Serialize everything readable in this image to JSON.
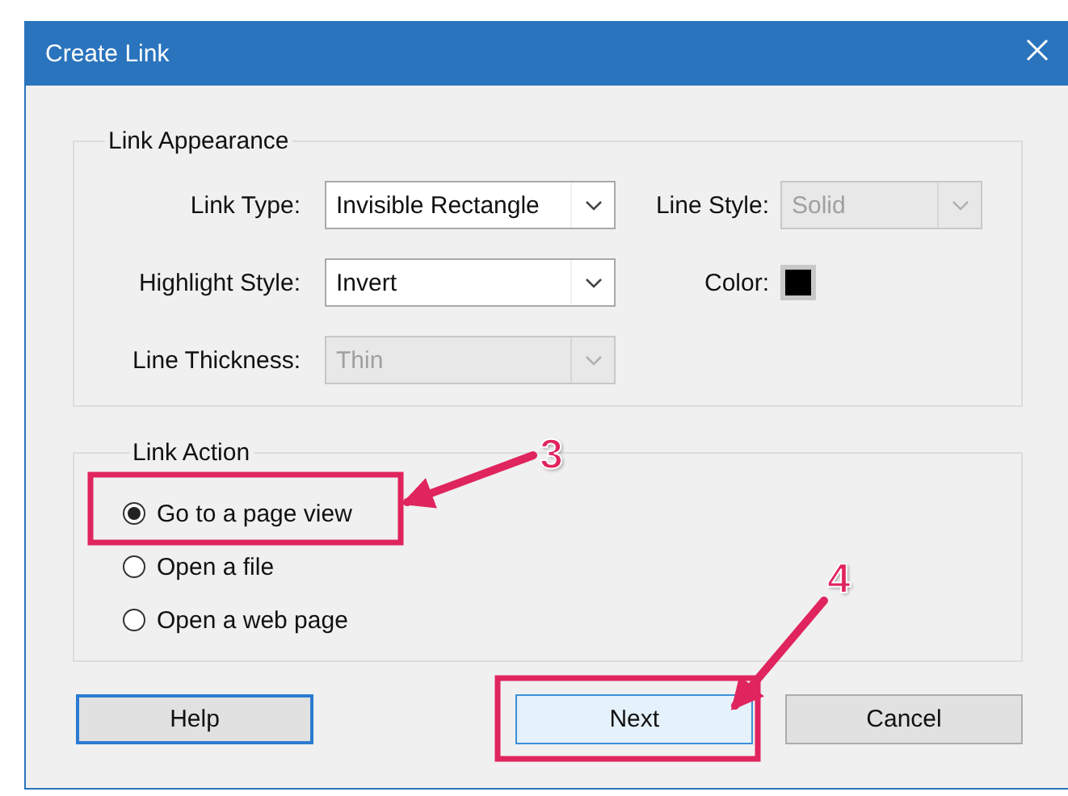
{
  "window": {
    "title": "Create Link"
  },
  "link_appearance": {
    "title": "Link Appearance",
    "fields": [
      {
        "label": "Link Type:",
        "value": "Invisible Rectangle",
        "disabled": false
      },
      {
        "label": "Line Style:",
        "value": "Solid",
        "disabled": true
      },
      {
        "label": "Highlight Style:",
        "value": "Invert",
        "disabled": false
      },
      {
        "label": "Line Thickness:",
        "value": "Thin",
        "disabled": true
      }
    ],
    "color": {
      "label": "Color:",
      "color": "#000000"
    }
  },
  "link_action": {
    "title": "Link Action",
    "options": [
      {
        "label": "Go to a page view",
        "selected": true
      },
      {
        "label": "Open a file",
        "selected": false
      },
      {
        "label": "Open a web page",
        "selected": false
      }
    ]
  },
  "buttons": [
    {
      "label": "Help",
      "focused": true,
      "highlighted": false
    },
    {
      "label": "Next",
      "focused": false,
      "highlighted": true
    },
    {
      "label": "Cancel",
      "focused": false,
      "highlighted": false
    }
  ],
  "annotations": [
    {
      "label": "3"
    },
    {
      "label": "4"
    }
  ]
}
